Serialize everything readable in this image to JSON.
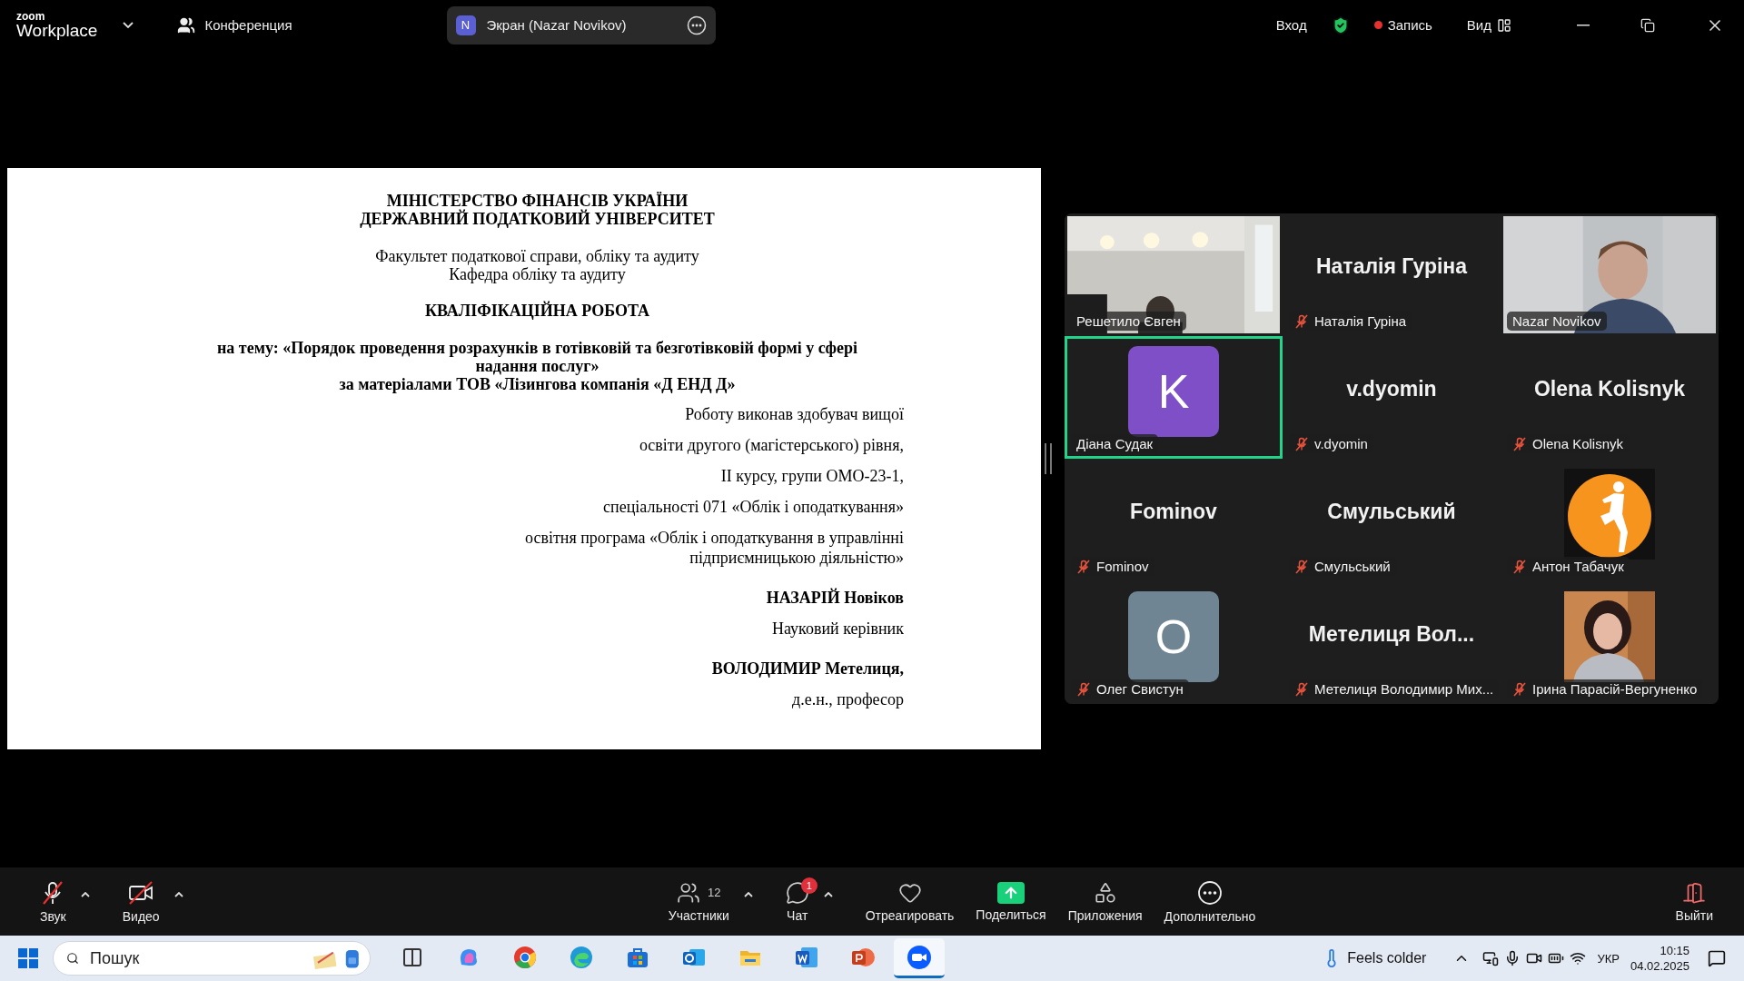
{
  "top_bar": {
    "brand": "zoom",
    "product": "Workplace",
    "meeting": "Конференция",
    "share": {
      "initial": "N",
      "label": "Экран (Nazar Novikov)"
    },
    "sign_in": "Вход",
    "recording": {
      "label": "Запись",
      "on": true
    },
    "view": "Вид"
  },
  "document": {
    "header": [
      "МІНІСТЕРСТВО ФІНАНСІВ УКРАЇНИ",
      "ДЕРЖАВНИЙ ПОДАТКОВИЙ УНІВЕРСИТЕТ"
    ],
    "faculty": [
      "Факультет податкової справи, обліку та аудиту",
      "Кафедра обліку та аудиту"
    ],
    "title": "КВАЛІФІКАЦІЙНА РОБОТА",
    "topic": [
      "на тему: «Порядок проведення розрахунків в готівковій та безготівковій формі у сфері надання послуг»",
      "за матеріалами ТОВ «Лізингова компанія «Д ЕНД Д»"
    ],
    "signature": [
      {
        "kind": "plain",
        "text": "Роботу виконав здобувач вищої"
      },
      {
        "kind": "plain",
        "text": "освіти другого (магістерського) рівня,"
      },
      {
        "kind": "plain",
        "text": "ІІ курсу, групи ОМО-23-1,"
      },
      {
        "kind": "plain",
        "text": "спеціальності 071 «Облік і оподаткування»"
      },
      {
        "kind": "plain",
        "text": "освітня програма «Облік і оподаткування в управлінні підприємницькою діяльністю»"
      },
      {
        "kind": "name",
        "text": "НАЗАРІЙ Новіков"
      },
      {
        "kind": "plain",
        "text": "Науковий керівник"
      },
      {
        "kind": "name",
        "text": "ВОЛОДИМИР Метелиця,"
      },
      {
        "kind": "plain",
        "text": "д.е.н., професор"
      }
    ]
  },
  "participants": [
    {
      "kind": "video",
      "name": "Решетило Євген",
      "muted": false,
      "selected": false
    },
    {
      "kind": "name",
      "display": "Наталія Гуріна",
      "name": "Наталія Гуріна",
      "muted": true,
      "selected": false
    },
    {
      "kind": "video",
      "name": "Nazar Novikov",
      "muted": false,
      "selected": false
    },
    {
      "kind": "letter",
      "letter": "K",
      "color": "#7e4fc6",
      "name": "Діана Судак",
      "muted": false,
      "selected": true
    },
    {
      "kind": "name",
      "display": "v.dyomin",
      "name": "v.dyomin",
      "muted": true,
      "selected": false
    },
    {
      "kind": "name",
      "display": "Olena Kolisnyk",
      "name": "Olena Kolisnyk",
      "muted": true,
      "selected": false
    },
    {
      "kind": "name",
      "display": "Fominov",
      "name": "Fominov",
      "muted": true,
      "selected": false
    },
    {
      "kind": "name",
      "display": "Смульський",
      "name": "Смульський",
      "muted": true,
      "selected": false
    },
    {
      "kind": "picture",
      "name": "Антон Табачук",
      "muted": true,
      "selected": false
    },
    {
      "kind": "letter",
      "letter": "O",
      "color": "#6f8594",
      "name": "Олег Свистун",
      "muted": true,
      "selected": false
    },
    {
      "kind": "name",
      "display": "Метелиця  Вол...",
      "name": "Метелиця Володимир Мих...",
      "muted": true,
      "selected": false
    },
    {
      "kind": "picture",
      "name": "Ірина Парасій-Вергуненко",
      "muted": true,
      "selected": false
    }
  ],
  "toolbar": [
    {
      "kind": "audio",
      "label": "Звук",
      "off": true,
      "menu": true
    },
    {
      "kind": "video",
      "label": "Видео",
      "off": true,
      "menu": true
    },
    {
      "kind": "participants",
      "label": "Участники",
      "count": "12",
      "menu": true
    },
    {
      "kind": "chat",
      "label": "Чат",
      "badge": "1",
      "menu": true
    },
    {
      "kind": "react",
      "label": "Отреагировать",
      "menu": false
    },
    {
      "kind": "share",
      "label": "Поделиться",
      "menu": false
    },
    {
      "kind": "apps",
      "label": "Приложения",
      "menu": false
    },
    {
      "kind": "more",
      "label": "Дополнительно",
      "menu": false
    },
    {
      "kind": "leave",
      "label": "Выйти",
      "menu": false
    }
  ],
  "taskbar": {
    "search": {
      "placeholder": "Пошук"
    },
    "apps": [
      {
        "kind": "taskview",
        "selected": false
      },
      {
        "kind": "copilot",
        "selected": false
      },
      {
        "kind": "chrome",
        "selected": false
      },
      {
        "kind": "edge",
        "selected": false
      },
      {
        "kind": "store",
        "selected": false
      },
      {
        "kind": "outlook",
        "selected": false
      },
      {
        "kind": "explorer",
        "selected": false
      },
      {
        "kind": "word",
        "selected": false
      },
      {
        "kind": "powerpoint",
        "selected": false
      },
      {
        "kind": "zoom",
        "selected": true
      }
    ],
    "weather": "Feels colder",
    "language": "УКР",
    "time": "10:15",
    "date": "04.02.2025"
  }
}
